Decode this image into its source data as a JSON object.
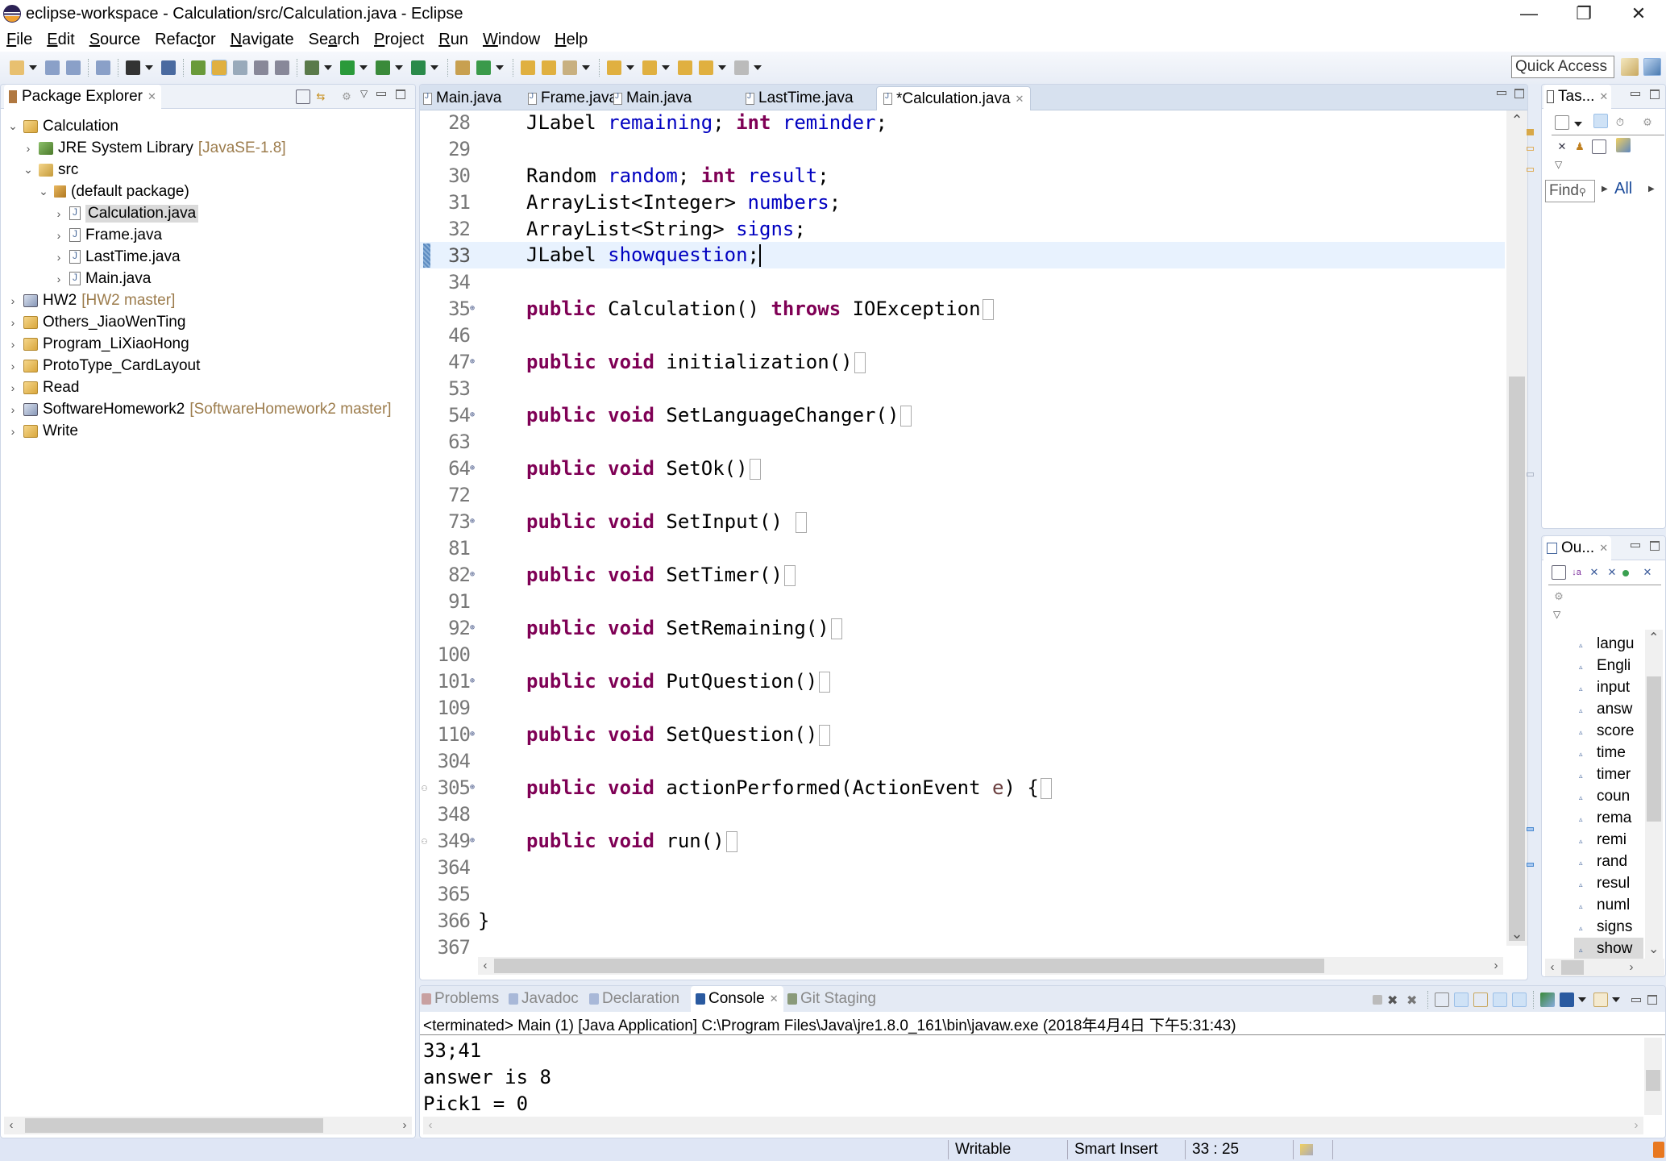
{
  "window": {
    "title": "eclipse-workspace - Calculation/src/Calculation.java - Eclipse",
    "controls": [
      "minimize",
      "restore",
      "close"
    ]
  },
  "menu": [
    {
      "label": "File",
      "mnemonic": "F"
    },
    {
      "label": "Edit",
      "mnemonic": "E"
    },
    {
      "label": "Source",
      "mnemonic": "S"
    },
    {
      "label": "Refactor",
      "mnemonic": "t"
    },
    {
      "label": "Navigate",
      "mnemonic": "N"
    },
    {
      "label": "Search",
      "mnemonic": "a"
    },
    {
      "label": "Project",
      "mnemonic": "P"
    },
    {
      "label": "Run",
      "mnemonic": "R"
    },
    {
      "label": "Window",
      "mnemonic": "W"
    },
    {
      "label": "Help",
      "mnemonic": "H"
    }
  ],
  "toolbar": {
    "quick_access": "Quick Access",
    "icons": [
      "new-icon",
      "save-icon",
      "save-all-icon",
      "binary-icon",
      "profile-icon",
      "skip-breakpoints-icon",
      "open-type-icon",
      "mark-occurrences-icon",
      "toggle-block-icon",
      "word-wrap-icon",
      "show-whitespace-icon",
      "debug-icon",
      "run-icon",
      "coverage-icon",
      "external-tools-icon",
      "new-java-package-icon",
      "new-class-icon",
      "open-task-icon",
      "open-folder-icon",
      "search-icon",
      "next-annotation-icon",
      "previous-annotation-icon",
      "last-edit-icon",
      "back-icon",
      "forward-icon"
    ]
  },
  "package_explorer": {
    "title": "Package Explorer",
    "tree": [
      {
        "label": "Calculation",
        "deco": "",
        "depth": 0,
        "expanded": true,
        "icon": "project-icon"
      },
      {
        "label": "JRE System Library",
        "deco": "[JavaSE-1.8]",
        "depth": 1,
        "expanded": false,
        "icon": "library-icon"
      },
      {
        "label": "src",
        "deco": "",
        "depth": 1,
        "expanded": true,
        "icon": "source-folder-icon"
      },
      {
        "label": "(default package)",
        "deco": "",
        "depth": 2,
        "expanded": true,
        "icon": "package-icon"
      },
      {
        "label": "Calculation.java",
        "deco": "",
        "depth": 3,
        "expanded": false,
        "icon": "java-file-icon",
        "selected": true
      },
      {
        "label": "Frame.java",
        "deco": "",
        "depth": 3,
        "expanded": false,
        "icon": "java-file-icon"
      },
      {
        "label": "LastTime.java",
        "deco": "",
        "depth": 3,
        "expanded": false,
        "icon": "java-file-icon"
      },
      {
        "label": "Main.java",
        "deco": "",
        "depth": 3,
        "expanded": false,
        "icon": "java-file-icon"
      },
      {
        "label": "HW2",
        "deco": "[HW2 master]",
        "depth": 0,
        "expanded": false,
        "icon": "git-project-icon"
      },
      {
        "label": "Others_JiaoWenTing",
        "deco": "",
        "depth": 0,
        "expanded": false,
        "icon": "project-icon"
      },
      {
        "label": "Program_LiXiaoHong",
        "deco": "",
        "depth": 0,
        "expanded": false,
        "icon": "project-icon"
      },
      {
        "label": "ProtoType_CardLayout",
        "deco": "",
        "depth": 0,
        "expanded": false,
        "icon": "project-icon"
      },
      {
        "label": "Read",
        "deco": "",
        "depth": 0,
        "expanded": false,
        "icon": "project-icon"
      },
      {
        "label": "SoftwareHomework2",
        "deco": "[SoftwareHomework2 master]",
        "depth": 0,
        "expanded": false,
        "icon": "git-project-icon"
      },
      {
        "label": "Write",
        "deco": "",
        "depth": 0,
        "expanded": false,
        "icon": "project-icon"
      }
    ]
  },
  "editor": {
    "tabs": [
      {
        "label": "Main.java",
        "active": false
      },
      {
        "label": "Frame.java",
        "active": false
      },
      {
        "label": "Main.java",
        "active": false
      },
      {
        "label": "LastTime.java",
        "active": false
      },
      {
        "label": "*Calculation.java",
        "active": true
      }
    ],
    "lines": [
      {
        "n": "28",
        "tokens": [
          [
            "typ",
            "JLabel "
          ],
          [
            "fld",
            "remaining"
          ],
          [
            "typ",
            "; "
          ],
          [
            "kw",
            "int "
          ],
          [
            "fld",
            "reminder"
          ],
          [
            "typ",
            ";"
          ]
        ]
      },
      {
        "n": "29",
        "tokens": []
      },
      {
        "n": "30",
        "tokens": [
          [
            "typ",
            "Random "
          ],
          [
            "fld",
            "random"
          ],
          [
            "typ",
            "; "
          ],
          [
            "kw",
            "int "
          ],
          [
            "fld",
            "result"
          ],
          [
            "typ",
            ";"
          ]
        ]
      },
      {
        "n": "31",
        "tokens": [
          [
            "typ",
            "ArrayList<Integer> "
          ],
          [
            "fld",
            "numbers"
          ],
          [
            "typ",
            ";"
          ]
        ]
      },
      {
        "n": "32",
        "tokens": [
          [
            "typ",
            "ArrayList<String> "
          ],
          [
            "fld",
            "signs"
          ],
          [
            "typ",
            ";"
          ]
        ]
      },
      {
        "n": "33",
        "tokens": [
          [
            "typ",
            "JLabel "
          ],
          [
            "fld",
            "showquestion"
          ],
          [
            "typ",
            ";"
          ]
        ],
        "current": true
      },
      {
        "n": "34",
        "tokens": []
      },
      {
        "n": "35",
        "fold": true,
        "tokens": [
          [
            "kw",
            "public "
          ],
          [
            "typ",
            "Calculation() "
          ],
          [
            "kw",
            "throws "
          ],
          [
            "typ",
            "IOException"
          ]
        ],
        "collapsed": true
      },
      {
        "n": "46",
        "tokens": []
      },
      {
        "n": "47",
        "fold": true,
        "tokens": [
          [
            "kw",
            "public "
          ],
          [
            "kw",
            "void "
          ],
          [
            "typ",
            "initialization()"
          ]
        ],
        "collapsed": true
      },
      {
        "n": "53",
        "tokens": []
      },
      {
        "n": "54",
        "fold": true,
        "tokens": [
          [
            "kw",
            "public "
          ],
          [
            "kw",
            "void "
          ],
          [
            "typ",
            "SetLanguageChanger()"
          ]
        ],
        "collapsed": true
      },
      {
        "n": "63",
        "tokens": []
      },
      {
        "n": "64",
        "fold": true,
        "tokens": [
          [
            "kw",
            "public "
          ],
          [
            "kw",
            "void "
          ],
          [
            "typ",
            "SetOk()"
          ]
        ],
        "collapsed": true
      },
      {
        "n": "72",
        "tokens": []
      },
      {
        "n": "73",
        "fold": true,
        "tokens": [
          [
            "kw",
            "public "
          ],
          [
            "kw",
            "void "
          ],
          [
            "typ",
            "SetInput() "
          ]
        ],
        "collapsed": true
      },
      {
        "n": "81",
        "tokens": []
      },
      {
        "n": "82",
        "fold": true,
        "tokens": [
          [
            "kw",
            "public "
          ],
          [
            "kw",
            "void "
          ],
          [
            "typ",
            "SetTimer()"
          ]
        ],
        "collapsed": true
      },
      {
        "n": "91",
        "tokens": []
      },
      {
        "n": "92",
        "fold": true,
        "tokens": [
          [
            "kw",
            "public "
          ],
          [
            "kw",
            "void "
          ],
          [
            "typ",
            "SetRemaining()"
          ]
        ],
        "collapsed": true
      },
      {
        "n": "100",
        "tokens": []
      },
      {
        "n": "101",
        "fold": true,
        "tokens": [
          [
            "kw",
            "public "
          ],
          [
            "kw",
            "void "
          ],
          [
            "typ",
            "PutQuestion()"
          ]
        ],
        "collapsed": true
      },
      {
        "n": "109",
        "tokens": []
      },
      {
        "n": "110",
        "fold": true,
        "tokens": [
          [
            "kw",
            "public "
          ],
          [
            "kw",
            "void "
          ],
          [
            "typ",
            "SetQuestion()"
          ]
        ],
        "collapsed": true
      },
      {
        "n": "304",
        "tokens": []
      },
      {
        "n": "305",
        "fold": true,
        "override": true,
        "tokens": [
          [
            "kw",
            "public "
          ],
          [
            "kw",
            "void "
          ],
          [
            "typ",
            "actionPerformed(ActionEvent "
          ],
          [
            "param",
            "e"
          ],
          [
            "typ",
            ") {"
          ]
        ],
        "collapsed": true
      },
      {
        "n": "348",
        "tokens": []
      },
      {
        "n": "349",
        "fold": true,
        "override": true,
        "tokens": [
          [
            "kw",
            "public "
          ],
          [
            "kw",
            "void "
          ],
          [
            "typ",
            "run()"
          ]
        ],
        "collapsed": true
      },
      {
        "n": "364",
        "tokens": []
      },
      {
        "n": "365",
        "tokens": []
      },
      {
        "n": "366",
        "tokens": [
          [
            "typ",
            "}"
          ]
        ],
        "nodent": true
      },
      {
        "n": "367",
        "tokens": []
      }
    ]
  },
  "tasks_view": {
    "title": "Tas...",
    "find_placeholder": "Find",
    "filter_label": "All"
  },
  "outline_view": {
    "title": "Ou...",
    "items": [
      "langu",
      "Engli",
      "input",
      "answ",
      "score",
      "time",
      "timer",
      "coun",
      "rema",
      "remi",
      "rand",
      "resul",
      "numl",
      "signs",
      "show"
    ],
    "selected": "show"
  },
  "console": {
    "tabs": [
      {
        "label": "Problems",
        "active": false
      },
      {
        "label": "Javadoc",
        "active": false
      },
      {
        "label": "Declaration",
        "active": false
      },
      {
        "label": "Console",
        "active": true
      },
      {
        "label": "Git Staging",
        "active": false
      }
    ],
    "description": "<terminated> Main (1) [Java Application] C:\\Program Files\\Java\\jre1.8.0_161\\bin\\javaw.exe (2018年4月4日 下午5:31:43)",
    "output": [
      "33;41",
      "answer is 8",
      "Pick1 = 0"
    ]
  },
  "statusbar": {
    "mode": "Writable",
    "insert": "Smart Insert",
    "position": "33 : 25"
  },
  "colors": {
    "keyword": "#7f0055",
    "field": "#0000c0",
    "current_line": "#e8f2fe",
    "deco": "#9c7c4c"
  }
}
